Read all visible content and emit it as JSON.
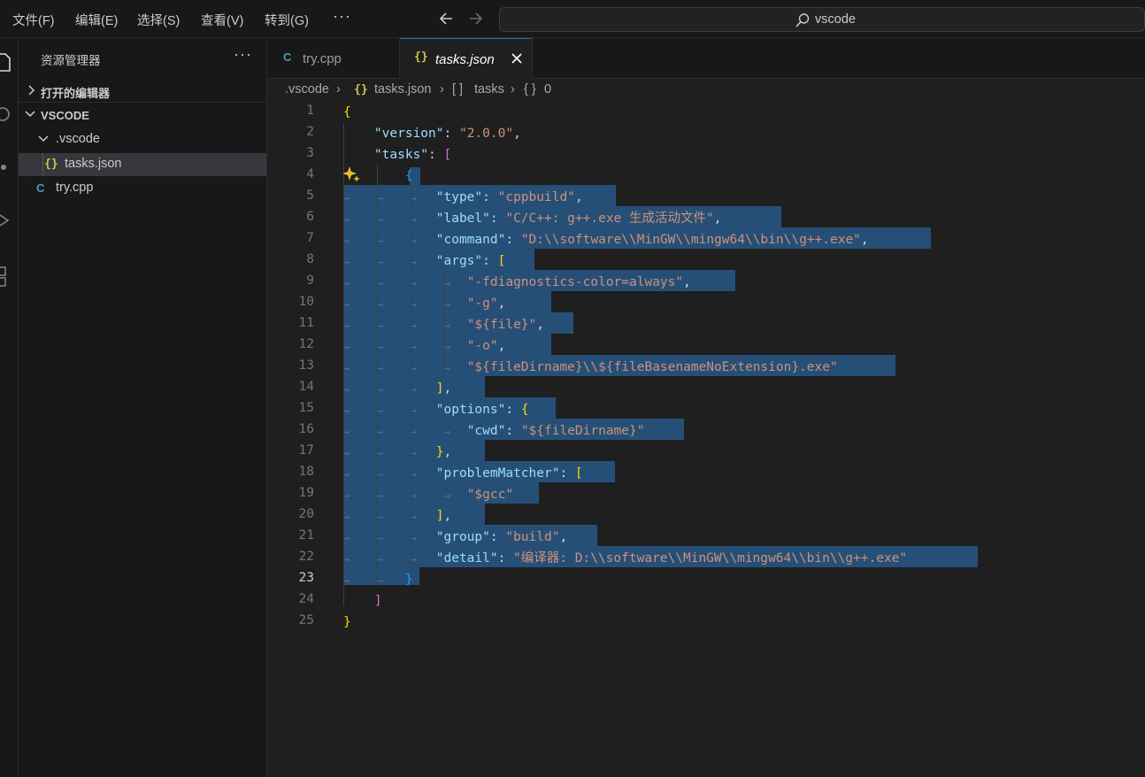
{
  "menu": {
    "file": "文件(F)",
    "edit": "编辑(E)",
    "select": "选择(S)",
    "view": "查看(V)",
    "goto": "转到(G)",
    "more": "···"
  },
  "search": {
    "text": "vscode"
  },
  "sidebar": {
    "title": "资源管理器",
    "more": "···",
    "open_editors": "打开的编辑器",
    "root": "VSCODE",
    "folder": ".vscode",
    "tasks_file": "tasks.json",
    "try_file": "try.cpp"
  },
  "tabs": {
    "try": "try.cpp",
    "tasks": "tasks.json"
  },
  "breadcrumb": {
    "folder": ".vscode",
    "file": "tasks.json",
    "array_icon": "[ ]",
    "array": "tasks",
    "object_icon": "{ }",
    "object": "0"
  },
  "icons": {
    "json": "{}",
    "cpp": "C"
  },
  "editor": {
    "current_line": 23,
    "line_numbers": [
      "1",
      "2",
      "3",
      "4",
      "5",
      "6",
      "7",
      "8",
      "9",
      "10",
      "11",
      "12",
      "13",
      "14",
      "15",
      "16",
      "17",
      "18",
      "19",
      "20",
      "21",
      "22",
      "23",
      "24",
      "25"
    ],
    "code": {
      "open_brace": "{",
      "version_key": "\"version\"",
      "version_val": "\"2.0.0\"",
      "tasks_key": "\"tasks\"",
      "arr_open": "[",
      "obj_open": "{",
      "type_key": "\"type\"",
      "type_val": "\"cppbuild\"",
      "label_key": "\"label\"",
      "label_val": "\"C/C++: g++.exe 生成活动文件\"",
      "command_key": "\"command\"",
      "command_val": "\"D:\\\\software\\\\MinGW\\\\mingw64\\\\bin\\\\g++.exe\"",
      "args_key": "\"args\"",
      "arg1": "\"-fdiagnostics-color=always\"",
      "arg2": "\"-g\"",
      "arg3": "\"${file}\"",
      "arg4": "\"-o\"",
      "arg5": "\"${fileDirname}\\\\${fileBasenameNoExtension}.exe\"",
      "options_key": "\"options\"",
      "cwd_key": "\"cwd\"",
      "cwd_val": "\"${fileDirname}\"",
      "matcher_key": "\"problemMatcher\"",
      "matcher_val": "\"$gcc\"",
      "group_key": "\"group\"",
      "group_val": "\"build\"",
      "detail_key": "\"detail\"",
      "detail_val": "\"编译器: D:\\\\software\\\\MinGW\\\\mingw64\\\\bin\\\\g++.exe\"",
      "obj_close": "}",
      "arr_close": "]",
      "close_brace": "}"
    }
  }
}
